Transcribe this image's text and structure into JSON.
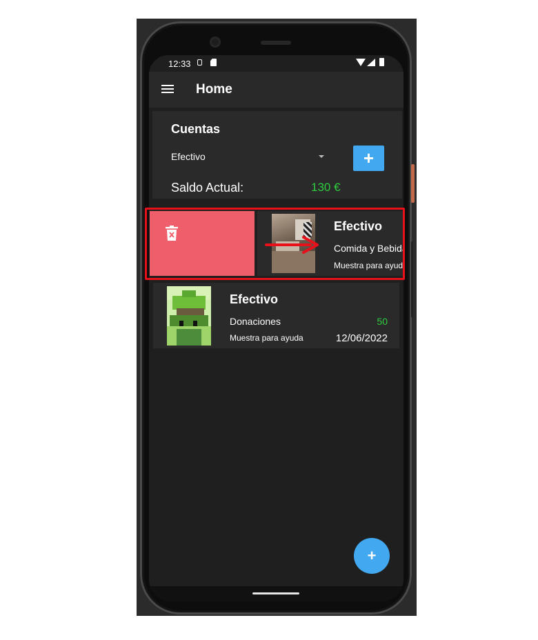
{
  "status_bar": {
    "time": "12:33"
  },
  "app_bar": {
    "title": "Home",
    "menu_icon": "hamburger-menu-icon"
  },
  "accounts_card": {
    "title": "Cuentas",
    "selected_account": "Efectivo",
    "add_button_label": "+",
    "balance_label": "Saldo Actual:",
    "balance_value": "130 €"
  },
  "transactions": [
    {
      "account": "Efectivo",
      "category": "Comida y Bebida",
      "description": "Muestra para ayuda",
      "state": "swiped-right",
      "delete_icon": "trash-icon"
    },
    {
      "account": "Efectivo",
      "category": "Donaciones",
      "amount": "50",
      "description": "Muestra para ayuda",
      "date": "12/06/2022"
    }
  ],
  "fab": {
    "label": "+"
  },
  "colors": {
    "accent": "#42a8f0",
    "positive": "#2ecc40",
    "delete": "#ef5f6b",
    "highlight": "#e8101a",
    "surface": "#2a2a2a",
    "background": "#1f1f1f"
  }
}
